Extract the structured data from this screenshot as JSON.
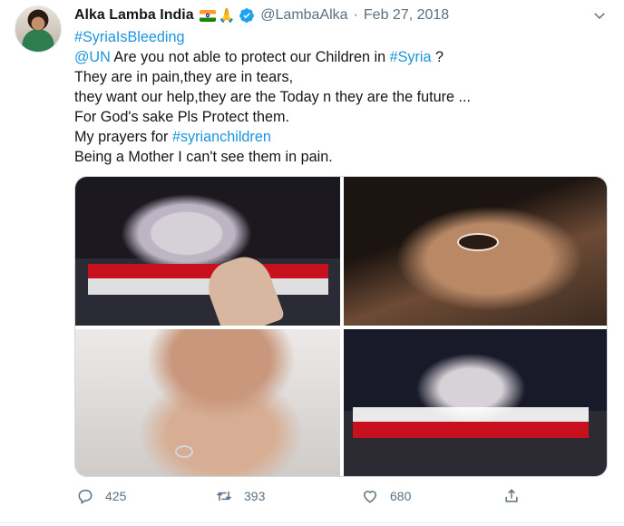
{
  "author": {
    "name": "Alka Lamba India",
    "emoji": "🙏",
    "handle": "@LambaAlka",
    "separator": "·",
    "date": "Feb 27, 2018"
  },
  "tweet": {
    "lines": [
      [
        {
          "t": "#SyriaIsBleeding",
          "link": true
        }
      ],
      [
        {
          "t": "@UN",
          "link": true
        },
        {
          "t": " Are you not able to protect our Children in ",
          "link": false
        },
        {
          "t": "#Syria",
          "link": true
        },
        {
          "t": " ?",
          "link": false
        }
      ],
      [
        {
          "t": "They are in pain,they are in tears,",
          "link": false
        }
      ],
      [
        {
          "t": "they want our help,they are the Today n they are the future ...",
          "link": false
        }
      ],
      [
        {
          "t": "For God's sake Pls Protect them.",
          "link": false
        }
      ],
      [
        {
          "t": "My prayers for ",
          "link": false
        },
        {
          "t": "#syrianchildren",
          "link": true
        }
      ],
      [
        {
          "t": "Being a Mother I can't see them in pain.",
          "link": false
        }
      ]
    ]
  },
  "stats": {
    "replies": "425",
    "retweets": "393",
    "likes": "680"
  },
  "colors": {
    "link": "#1b95e0",
    "muted": "#5b7083",
    "text": "#14171a"
  }
}
